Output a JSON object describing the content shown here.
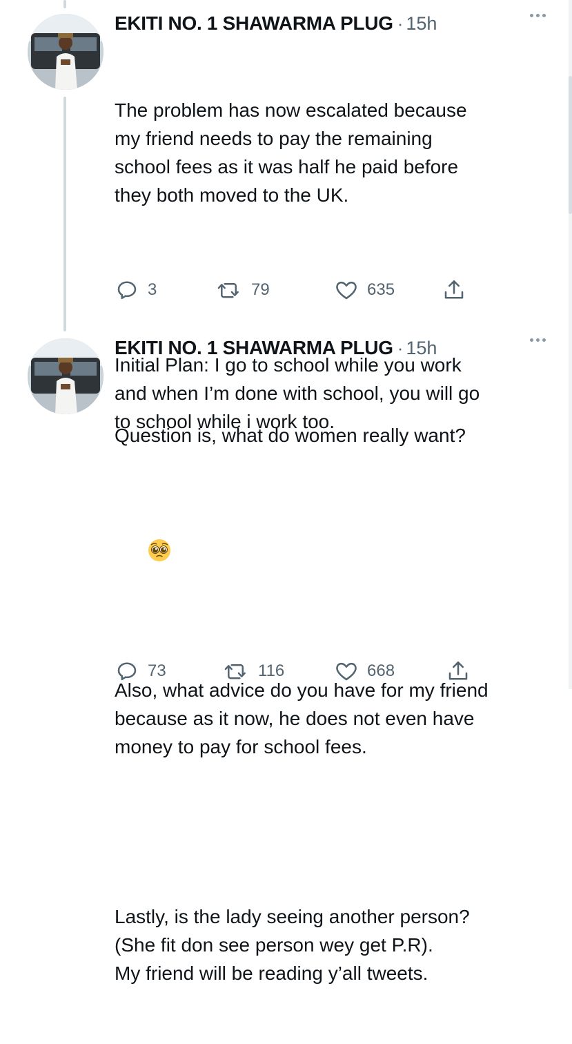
{
  "accent_color": "#536471",
  "tweets": [
    {
      "author": "EKITI NO. 1 SHAWARMA PLUG",
      "time": "15h",
      "paragraphs": [
        "The problem has now escalated because\nmy friend needs to pay the remaining\nschool fees as it was half he paid before\nthey both moved to the UK.",
        "Initial Plan: I go to school while you work\nand when I’m done with school, you will go\nto school while i work too."
      ],
      "replies": "3",
      "retweets": "79",
      "likes": "635"
    },
    {
      "author": "EKITI NO. 1 SHAWARMA PLUG",
      "time": "15h",
      "first_line": "Question is, what do women really want?",
      "emoji": "pleading-face-emoji",
      "paragraphs": [
        "Also, what advice do you have for my friend\nbecause as it now, he does not even have\nmoney to pay for school fees.",
        "Lastly, is the lady seeing another person?\n(She fit don see person wey get P.R).\nMy friend will be reading y’all tweets."
      ],
      "replies": "73",
      "retweets": "116",
      "likes": "668"
    }
  ],
  "icons": {
    "reply": "reply-icon",
    "retweet": "retweet-icon",
    "like": "like-icon",
    "share": "share-icon",
    "more": "more-icon"
  }
}
